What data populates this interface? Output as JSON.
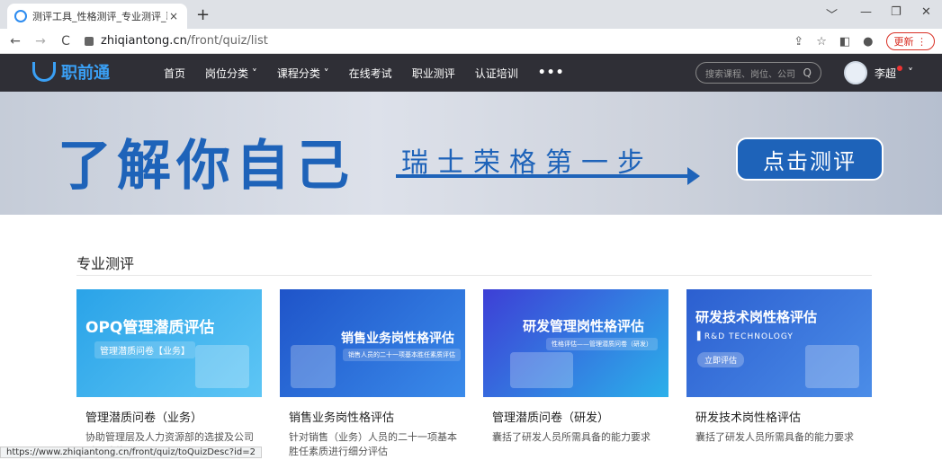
{
  "browser": {
    "tab_title": "测评工具_性格测评_专业测评_职",
    "tab_close": "×",
    "new_tab": "+",
    "url_host": "zhiqiantong.cn",
    "url_path": "/front/quiz/list",
    "update_label": "更新",
    "win_min": "﹀",
    "win_dash": "—",
    "win_restore": "❐",
    "win_close": "✕",
    "status_url": "https://www.zhiqiantong.cn/front/quiz/toQuizDesc?id=2"
  },
  "site": {
    "logo_text": "职前通",
    "nav": [
      "首页",
      "岗位分类 ˅",
      "课程分类 ˅",
      "在线考试",
      "职业测评",
      "认证培训"
    ],
    "nav_more": "•••",
    "search_placeholder": "搜索课程、岗位、公司",
    "user_name": "李超",
    "user_caret": "˅"
  },
  "banner": {
    "headline": "了解你自己",
    "subline": "瑞士荣格第一步",
    "cta": "点击测评"
  },
  "section": {
    "title": "专业测评"
  },
  "cards": [
    {
      "thumb_title": "OPQ管理潜质评估",
      "thumb_sub": "管理潜质问卷【业务】",
      "name": "管理潜质问卷（业务）",
      "desc": "协助管理层及人力资源部的选拔及公司对人才的评价",
      "color1": "#2aa3e8",
      "color2": "#5ec6f5"
    },
    {
      "thumb_title": "销售业务岗性格评估",
      "thumb_sub": "销售人员的二十一项基本胜任素质评估",
      "name": "销售业务岗性格评估",
      "desc": "针对销售（业务）人员的二十一项基本胜任素质进行细分评估",
      "color1": "#1f54c9",
      "color2": "#3a8bea"
    },
    {
      "thumb_title": "研发管理岗性格评估",
      "thumb_sub": "性格评估——管理潜质问卷（研发）",
      "name": "管理潜质问卷（研发）",
      "desc": "囊括了研发人员所需具备的能力要求",
      "color1": "#3d3fd6",
      "color2": "#2bb0ea"
    },
    {
      "thumb_title": "研发技术岗性格评估",
      "thumb_en": "▌R&D TECHNOLOGY",
      "thumb_btn": "立即评估",
      "name": "研发技术岗性格评估",
      "desc": "囊括了研发人员所需具备的能力要求",
      "color1": "#2c5fd0",
      "color2": "#4b8de8"
    }
  ]
}
